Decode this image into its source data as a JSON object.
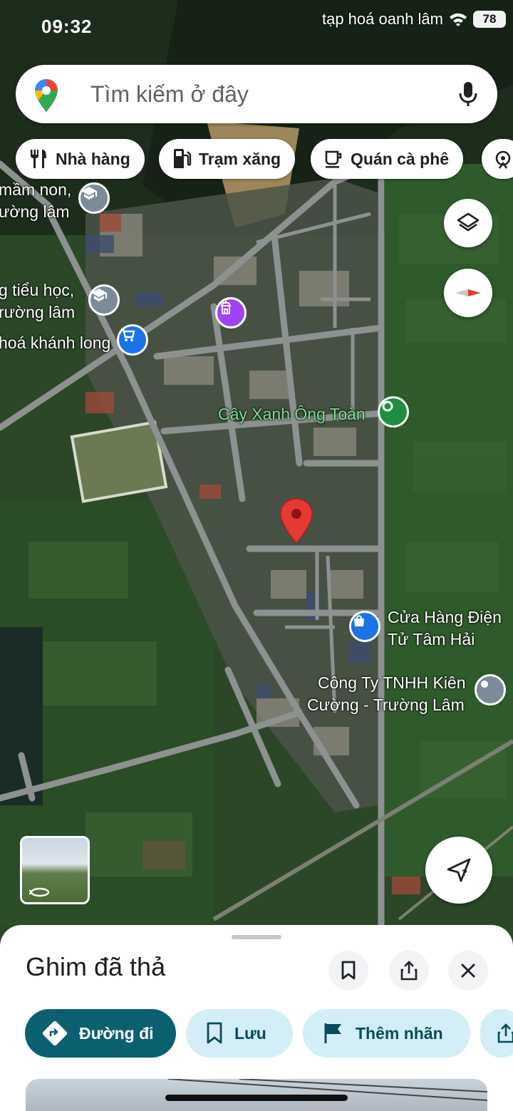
{
  "status_bar": {
    "time": "09:32",
    "battery": "78",
    "poi_top": "tạp hoá oanh lâm"
  },
  "search": {
    "placeholder": "Tìm kiếm ở đây"
  },
  "chips": [
    {
      "label": "Nhà hàng",
      "icon": "restaurant-icon"
    },
    {
      "label": "Trạm xăng",
      "icon": "gas-station-icon"
    },
    {
      "label": "Quán cà phê",
      "icon": "coffee-icon"
    }
  ],
  "map_labels": {
    "mam_non_1": "mầm non,",
    "mam_non_2": "ường lâm",
    "tieu_hoc_1": "g tiểu học,",
    "tieu_hoc_2": "rường lâm",
    "khanh_long": "hoá khánh long",
    "cay_xanh": "Cây Xanh Ông Toàn",
    "dien_tu_1": "Cửa Hàng Điện",
    "dien_tu_2": "Tử Tâm Hải",
    "cong_ty_1": "Công Ty TNHH Kiên",
    "cong_ty_2": "Cường - Trường Lâm"
  },
  "colors": {
    "sheet_primary": "#0b6070",
    "sheet_secondary": "#d3eef6",
    "pin_red": "#e53935",
    "poi_school": "#7b8b97",
    "poi_shop": "#1a73e8",
    "poi_temple": "#a142f4",
    "poi_park": "#1e8e3e"
  },
  "bottom_sheet": {
    "title": "Ghim đã thả",
    "actions": {
      "directions": "Đường đi",
      "save": "Lưu",
      "label": "Thêm nhãn"
    }
  }
}
